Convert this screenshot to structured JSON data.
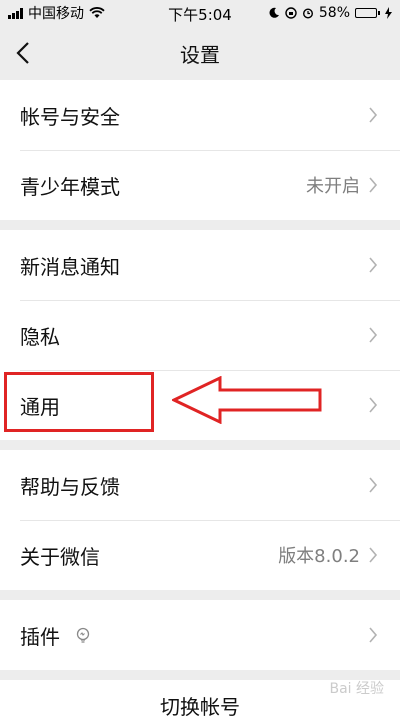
{
  "status_bar": {
    "carrier": "中国移动",
    "time": "下午5:04",
    "battery_percent": "58%",
    "battery_level": 0.58
  },
  "nav": {
    "title": "设置"
  },
  "groups": [
    {
      "rows": [
        {
          "label": "帐号与安全",
          "value": ""
        },
        {
          "label": "青少年模式",
          "value": "未开启"
        }
      ]
    },
    {
      "rows": [
        {
          "label": "新消息通知",
          "value": ""
        },
        {
          "label": "隐私",
          "value": ""
        },
        {
          "label": "通用",
          "value": ""
        }
      ]
    },
    {
      "rows": [
        {
          "label": "帮助与反馈",
          "value": ""
        },
        {
          "label": "关于微信",
          "value": "版本8.0.2"
        }
      ]
    },
    {
      "rows": [
        {
          "label": "插件",
          "value": ""
        }
      ]
    }
  ],
  "footer": {
    "switch_account": "切换帐号"
  },
  "watermark": "Bai 经验",
  "colors": {
    "highlight": "#e02424",
    "background": "#ededed",
    "value_text": "#7f7f7f"
  }
}
